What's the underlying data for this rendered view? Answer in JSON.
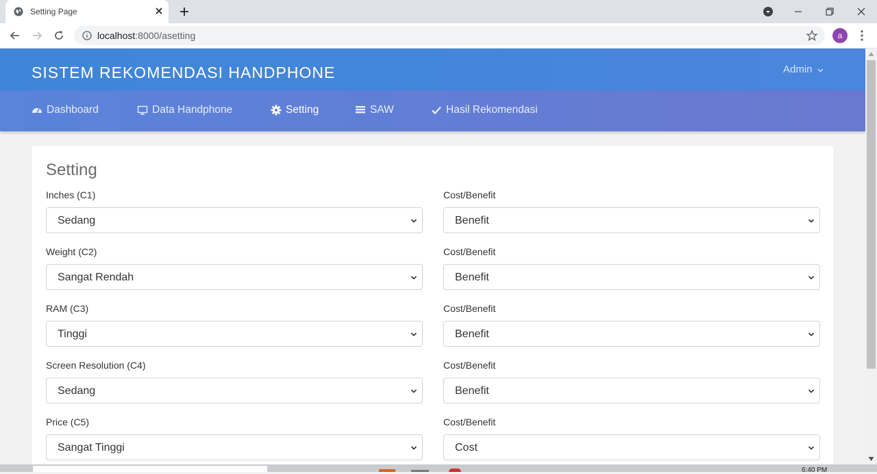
{
  "browser": {
    "tab_title": "Setting Page",
    "url_host": "localhost",
    "url_path": ":8000/asetting",
    "profile_initial": "a"
  },
  "app": {
    "brand": "SISTEM REKOMENDASI HANDPHONE",
    "user_menu": "Admin",
    "nav": [
      {
        "label": "Dashboard",
        "icon": "tachometer-icon"
      },
      {
        "label": "Data Handphone",
        "icon": "desktop-icon"
      },
      {
        "label": "Setting",
        "icon": "gear-icon"
      },
      {
        "label": "SAW",
        "icon": "list-icon"
      },
      {
        "label": "Hasil Rekomendasi",
        "icon": "check-icon"
      }
    ]
  },
  "page": {
    "title": "Setting",
    "criteria": [
      {
        "label": "Inches (C1)",
        "value": "Sedang",
        "type_label": "Cost/Benefit",
        "type_value": "Benefit"
      },
      {
        "label": "Weight (C2)",
        "value": "Sangat Rendah",
        "type_label": "Cost/Benefit",
        "type_value": "Benefit"
      },
      {
        "label": "RAM (C3)",
        "value": "Tinggi",
        "type_label": "Cost/Benefit",
        "type_value": "Benefit"
      },
      {
        "label": "Screen Resolution (C4)",
        "value": "Sedang",
        "type_label": "Cost/Benefit",
        "type_value": "Benefit"
      },
      {
        "label": "Price (C5)",
        "value": "Sangat Tinggi",
        "type_label": "Cost/Benefit",
        "type_value": "Cost"
      }
    ]
  },
  "taskbar": {
    "clock": "6:40 PM"
  },
  "colors": {
    "header": "#3f86d8",
    "navbar": "#6a78cf",
    "avatar": "#8e44ad"
  }
}
